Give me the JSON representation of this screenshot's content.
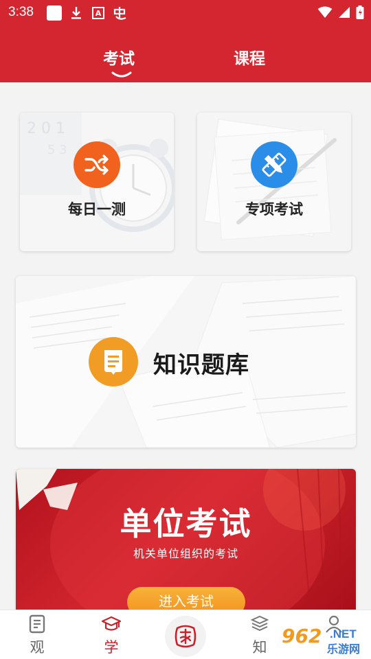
{
  "status_bar": {
    "time": "3:38"
  },
  "tabs": [
    {
      "label": "考试",
      "active": true
    },
    {
      "label": "课程",
      "active": false
    }
  ],
  "cards": {
    "daily": {
      "label": "每日一测",
      "icon": "shuffle-icon",
      "color": "#f0621e"
    },
    "special": {
      "label": "专项考试",
      "icon": "pencil-ruler-icon",
      "color": "#2a8ee8"
    },
    "bank": {
      "label": "知识题库",
      "icon": "document-icon",
      "color": "#f19d25"
    },
    "unit": {
      "title": "单位考试",
      "subtitle": "机关单位组织的考试",
      "button": "进入考试"
    }
  },
  "bottom_nav": [
    {
      "label": "观",
      "icon": "document-list-icon",
      "active": false
    },
    {
      "label": "学",
      "icon": "graduation-cap-icon",
      "active": true
    },
    {
      "label": "",
      "icon": "seal-logo-icon",
      "active": false
    },
    {
      "label": "知",
      "icon": "books-icon",
      "active": false
    },
    {
      "label": "",
      "icon": "person-icon",
      "active": false
    }
  ],
  "watermark": {
    "number": "962",
    "net": ".NET",
    "site": "乐游网"
  },
  "colors": {
    "header": "#d42630",
    "active_nav": "#c8222c",
    "button": "#f2921f"
  }
}
